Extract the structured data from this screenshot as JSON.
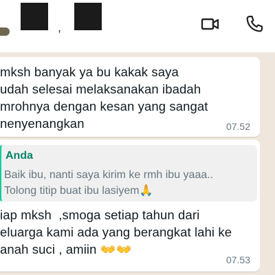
{
  "header": {
    "contact_suffix": ",",
    "icons": [
      "video-call-icon",
      "voice-call-icon"
    ]
  },
  "messages": [
    {
      "lines": [
        "mksh banyak ya bu kakak saya",
        "udah selesai melaksanakan ibadah",
        "mrohnya dengan kesan yang sangat",
        "nenyenangkan"
      ],
      "time": "07.52"
    },
    {
      "quote": {
        "author": "Anda",
        "lines": [
          "Baik ibu, nanti saya kirim ke rmh ibu yaaa..",
          "Tolong titip buat ibu lasiyem🙏"
        ]
      },
      "lines": [
        "iap mksh  ,smoga setiap tahun dari",
        "eluarga kami ada yang berangkat lahi ke",
        "anah suci , amiin 👐👐"
      ],
      "time": "07.53"
    }
  ],
  "colors": {
    "chat_background": "#efe7dd",
    "bubble": "#ffffff",
    "quote_accent": "#06cf9c",
    "quote_author": "#06846a",
    "timestamp": "#667781"
  }
}
